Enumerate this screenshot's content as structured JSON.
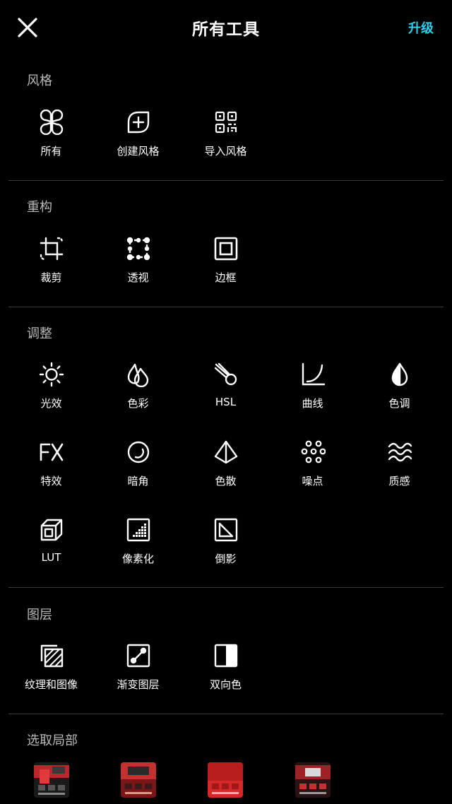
{
  "header": {
    "title": "所有工具",
    "upgrade_label": "升级",
    "close_icon": "close-icon"
  },
  "accent_color": "#2fd0ea",
  "sections": {
    "style": {
      "title": "风格",
      "items": [
        {
          "label": "所有",
          "icon": "four-petal-grid-icon"
        },
        {
          "label": "创建风格",
          "icon": "add-style-icon"
        },
        {
          "label": "导入风格",
          "icon": "qr-code-icon"
        }
      ]
    },
    "reconstruct": {
      "title": "重构",
      "items": [
        {
          "label": "裁剪",
          "icon": "crop-icon"
        },
        {
          "label": "透视",
          "icon": "perspective-icon"
        },
        {
          "label": "边框",
          "icon": "frame-icon"
        }
      ]
    },
    "adjust": {
      "title": "调整",
      "items": [
        {
          "label": "光效",
          "icon": "sun-icon"
        },
        {
          "label": "色彩",
          "icon": "color-drops-icon"
        },
        {
          "label": "HSL",
          "icon": "hsl-comet-icon"
        },
        {
          "label": "曲线",
          "icon": "curve-icon"
        },
        {
          "label": "色调",
          "icon": "tone-drop-icon"
        },
        {
          "label": "特效",
          "icon": "fx-icon"
        },
        {
          "label": "暗角",
          "icon": "vignette-icon"
        },
        {
          "label": "色散",
          "icon": "prism-icon"
        },
        {
          "label": "噪点",
          "icon": "grain-dots-icon"
        },
        {
          "label": "质感",
          "icon": "texture-waves-icon"
        },
        {
          "label": "LUT",
          "icon": "lut-cube-icon"
        },
        {
          "label": "像素化",
          "icon": "pixelate-icon"
        },
        {
          "label": "倒影",
          "icon": "reflection-icon"
        }
      ]
    },
    "layers": {
      "title": "图层",
      "items": [
        {
          "label": "纹理和图像",
          "icon": "texture-image-icon"
        },
        {
          "label": "渐变图层",
          "icon": "gradient-layer-icon"
        },
        {
          "label": "双向色",
          "icon": "duotone-icon"
        }
      ]
    },
    "select": {
      "title": "选取局部"
    }
  }
}
